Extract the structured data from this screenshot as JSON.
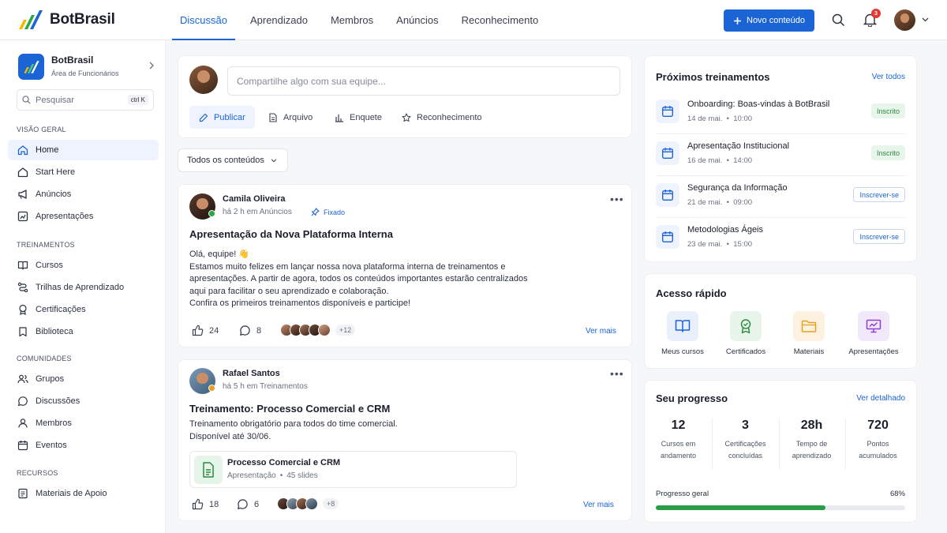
{
  "app": {
    "name": "BotBrasil",
    "accent": "#1a64d6"
  },
  "topnav": {
    "tabs": [
      "Discussão",
      "Aprendizado",
      "Membros",
      "Anúncios",
      "Reconhecimento"
    ],
    "active_tab": "Discussão",
    "new_button": "Novo conteúdo",
    "notifications_count": "3"
  },
  "sidebar": {
    "org_name": "BotBrasil",
    "org_subtitle": "Área de Funcionários",
    "search_placeholder": "Pesquisar",
    "search_shortcut": "ctrl K",
    "sections": [
      {
        "title": "VISÃO GERAL",
        "items": [
          {
            "label": "Home",
            "icon": "home-icon",
            "active": true
          },
          {
            "label": "Start Here",
            "icon": "house-outline-icon"
          },
          {
            "label": "Anúncios",
            "icon": "megaphone-icon"
          },
          {
            "label": "Apresentações",
            "icon": "presentation-icon"
          }
        ]
      },
      {
        "title": "TREINAMENTOS",
        "items": [
          {
            "label": "Cursos",
            "icon": "book-icon"
          },
          {
            "label": "Trilhas de Aprendizado",
            "icon": "route-icon"
          },
          {
            "label": "Certificações",
            "icon": "award-icon"
          },
          {
            "label": "Biblioteca",
            "icon": "library-icon"
          }
        ]
      },
      {
        "title": "COMUNIDADES",
        "items": [
          {
            "label": "Grupos",
            "icon": "users-icon"
          },
          {
            "label": "Discussões",
            "icon": "chat-icon"
          },
          {
            "label": "Membros",
            "icon": "user-icon"
          },
          {
            "label": "Eventos",
            "icon": "calendar-icon"
          }
        ]
      },
      {
        "title": "RECURSOS",
        "items": [
          {
            "label": "Materiais de Apoio",
            "icon": "document-icon"
          }
        ]
      }
    ]
  },
  "composer": {
    "placeholder": "Compartilhe algo com sua equipe...",
    "actions": [
      "Publicar",
      "Arquivo",
      "Enquete",
      "Reconhecimento"
    ]
  },
  "filter": {
    "label": "Todos os conteúdos"
  },
  "posts": [
    {
      "author": "Camila Oliveira",
      "meta": "há 2 h em Anúncios",
      "pinned_label": "Fixado",
      "title": "Apresentação da Nova Plataforma Interna",
      "body": [
        "Olá, equipe! 👋",
        "Estamos muito felizes em lançar nossa nova plataforma interna de treinamentos e",
        "apresentações. A partir de agora, todos os conteúdos importantes estarão centralizados",
        "aqui para facilitar o seu aprendizado e colaboração.",
        "Confira os primeiros treinamentos disponíveis e participe!"
      ],
      "likes": "24",
      "comments": "8",
      "more_people": "+12",
      "see_more": "Ver mais"
    },
    {
      "author": "Rafael Santos",
      "meta": "há 5 h em Treinamentos",
      "title": "Treinamento: Processo Comercial e CRM",
      "body": [
        "Treinamento obrigatório para todos do time comercial.",
        "Disponível até 30/06."
      ],
      "attachment": {
        "title": "Processo Comercial e CRM",
        "type": "Apresentação",
        "detail": "45 slides"
      },
      "likes": "18",
      "comments": "6",
      "more_people": "+8",
      "see_more": "Ver mais"
    }
  ],
  "trainings": {
    "title": "Próximos treinamentos",
    "link": "Ver todos",
    "items": [
      {
        "title": "Onboarding: Boas-vindas à BotBrasil",
        "date": "14 de mai.",
        "time": "10:00",
        "status": "Inscrito",
        "status_kind": "enrolled"
      },
      {
        "title": "Apresentação Institucional",
        "date": "16 de mai.",
        "time": "14:00",
        "status": "Inscrito",
        "status_kind": "enrolled"
      },
      {
        "title": "Segurança da Informação",
        "date": "21 de mai.",
        "time": "09:00",
        "status": "Inscrever-se",
        "status_kind": "action"
      },
      {
        "title": "Metodologias Ágeis",
        "date": "23 de mai.",
        "time": "15:00",
        "status": "Inscrever-se",
        "status_kind": "action"
      }
    ]
  },
  "quick_access": {
    "title": "Acesso rápido",
    "items": [
      {
        "label": "Meus cursos",
        "icon": "book-open-icon",
        "color": "#1a64d6",
        "bg": "#e9f0fc"
      },
      {
        "label": "Certificados",
        "icon": "award-icon",
        "color": "#2e8b43",
        "bg": "#e7f5ea"
      },
      {
        "label": "Materiais",
        "icon": "folder-icon",
        "color": "#e8a020",
        "bg": "#fdf1e0"
      },
      {
        "label": "Apresentações",
        "icon": "monitor-icon",
        "color": "#8e3fd0",
        "bg": "#f1e8fb"
      }
    ]
  },
  "progress": {
    "title": "Seu progresso",
    "link": "Ver detalhado",
    "stats": [
      {
        "value": "12",
        "label_1": "Cursos em",
        "label_2": "andamento"
      },
      {
        "value": "3",
        "label_1": "Certificações",
        "label_2": "concluídas"
      },
      {
        "value": "28h",
        "label_1": "Tempo de",
        "label_2": "aprendizado"
      },
      {
        "value": "720",
        "label_1": "Pontos",
        "label_2": "acumulados"
      }
    ],
    "overall_label": "Progresso geral",
    "overall_value": "68%",
    "overall_fraction": 0.68,
    "bar_color": "#2a9d48"
  }
}
